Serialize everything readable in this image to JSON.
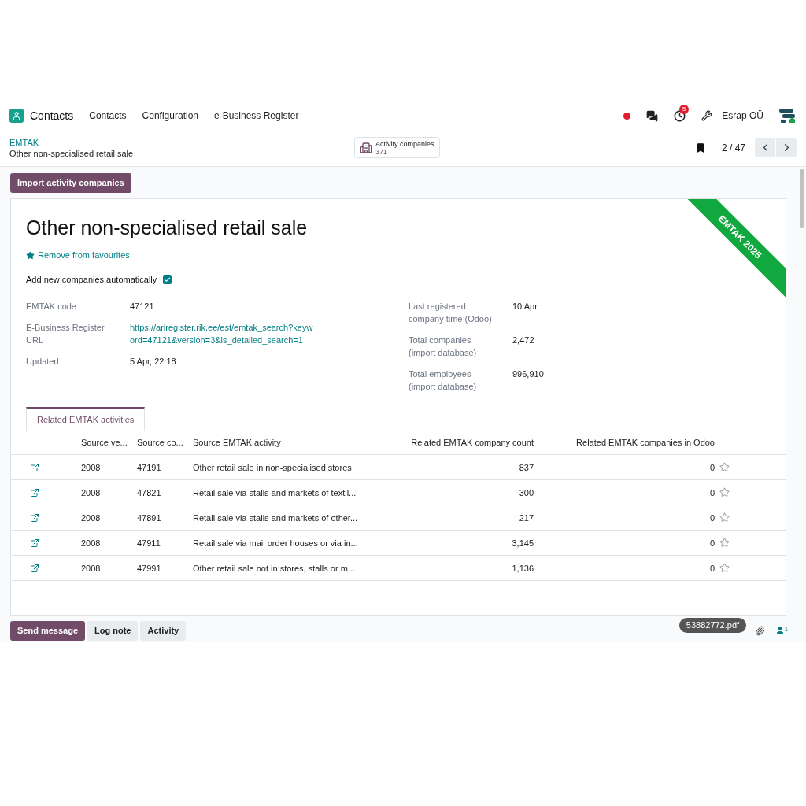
{
  "navbar": {
    "app_name": "Contacts",
    "menu": [
      "Contacts",
      "Configuration",
      "e-Business Register"
    ],
    "activity_badge": "5",
    "company": "Esrap OÜ"
  },
  "control_panel": {
    "breadcrumb": "EMTAK",
    "record": "Other non-specialised retail sale",
    "smart_button": {
      "label": "Activity companies",
      "count": "371"
    },
    "pager": "2 / 47"
  },
  "import_button": "Import activity companies",
  "sheet": {
    "title": "Other non-specialised retail sale",
    "ribbon": "EMTAK 2025",
    "favourite_link": "Remove from favourites",
    "auto_add": {
      "label": "Add new companies automatically",
      "checked": true
    },
    "left_fields": [
      {
        "label": "EMTAK code",
        "value": "47121",
        "kind": "text"
      },
      {
        "label": "E-Business Register URL",
        "value": "https://ariregister.rik.ee/est/emtak_search?keyword=47121&version=3&is_detailed_search=1",
        "kind": "link"
      },
      {
        "label": "Updated",
        "value": "5 Apr, 22:18",
        "kind": "text"
      }
    ],
    "right_fields": [
      {
        "label": "Last registered company time (Odoo)",
        "value": "10 Apr"
      },
      {
        "label": "Total companies (import database)",
        "value": "2,472"
      },
      {
        "label": "Total employees (import database)",
        "value": "996,910"
      }
    ],
    "tabs": [
      {
        "label": "Related EMTAK activities",
        "selected": true
      }
    ],
    "table": {
      "columns": [
        "Source ve...",
        "Source co...",
        "Source EMTAK activity",
        "Related EMTAK company count",
        "Related EMTAK companies in Odoo"
      ],
      "rows": [
        {
          "version": "2008",
          "code": "47191",
          "activity": "Other retail sale in non-specialised stores",
          "count": "837",
          "odoo": "0",
          "starred": false
        },
        {
          "version": "2008",
          "code": "47821",
          "activity": "Retail sale via stalls and markets of textil...",
          "count": "300",
          "odoo": "0",
          "starred": false
        },
        {
          "version": "2008",
          "code": "47891",
          "activity": "Retail sale via stalls and markets of other...",
          "count": "217",
          "odoo": "0",
          "starred": false
        },
        {
          "version": "2008",
          "code": "47911",
          "activity": "Retail sale via mail order houses or via in...",
          "count": "3,145",
          "odoo": "0",
          "starred": false
        },
        {
          "version": "2008",
          "code": "47991",
          "activity": "Other retail sale not in stores, stalls or m...",
          "count": "1,136",
          "odoo": "0",
          "starred": false
        }
      ]
    }
  },
  "chatter": {
    "buttons": [
      {
        "label": "Send message",
        "selected": true
      },
      {
        "label": "Log note",
        "selected": false
      },
      {
        "label": "Activity",
        "selected": false
      }
    ],
    "tooltip": "53882772.pdf",
    "followers": "1"
  }
}
